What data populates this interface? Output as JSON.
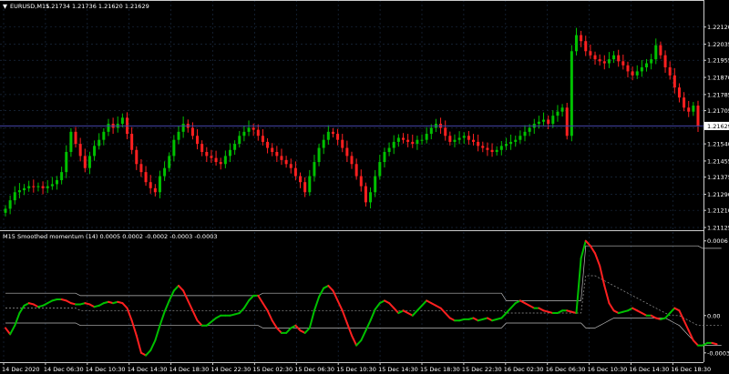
{
  "symbol_header": {
    "arrow": "▼",
    "title": "EURUSD,M15",
    "ohlc": "1.21734 1.21736 1.21620 1.21629"
  },
  "indicator_header": {
    "text": "M15 Smoothed momentum (14) 0.0005 0.0002 -0.0002 -0.0003 -0.0003"
  },
  "price_axis": {
    "ticks": [
      "1.22120",
      "1.22035",
      "1.21955",
      "1.21870",
      "1.21785",
      "1.21705",
      "1.21620",
      "1.21540",
      "1.21455",
      "1.21375",
      "1.21290",
      "1.21210",
      "1.21125"
    ],
    "current_price_label": "1.21629"
  },
  "indicator_axis": {
    "ticks": [
      "0.0006",
      "0.00",
      "-0.0003"
    ]
  },
  "time_axis": {
    "ticks": [
      "14 Dec 2020",
      "14 Dec 06:30",
      "14 Dec 10:30",
      "14 Dec 14:30",
      "14 Dec 18:30",
      "14 Dec 22:30",
      "15 Dec 02:30",
      "15 Dec 06:30",
      "15 Dec 10:30",
      "15 Dec 14:30",
      "15 Dec 18:30",
      "15 Dec 22:30",
      "16 Dec 02:30",
      "16 Dec 06:30",
      "16 Dec 10:30",
      "16 Dec 14:30",
      "16 Dec 18:30"
    ]
  },
  "colors": {
    "background": "#000000",
    "grid": "#1a2a40",
    "bull": "#00c000",
    "bear": "#ff2020",
    "current_line": "#4444aa",
    "frame": "#cccccc"
  },
  "chart_data": [
    {
      "type": "candlestick",
      "symbol": "EURUSD",
      "timeframe": "M15",
      "close": [
        1.21218,
        1.2126,
        1.213,
        1.2131,
        1.2132,
        1.2133,
        1.21325,
        1.2133,
        1.2132,
        1.2133,
        1.2134,
        1.2136,
        1.214,
        1.215,
        1.216,
        1.2154,
        1.2148,
        1.2142,
        1.2148,
        1.2153,
        1.2156,
        1.216,
        1.2164,
        1.2162,
        1.2164,
        1.2167,
        1.2159,
        1.2151,
        1.2144,
        1.214,
        1.2135,
        1.2132,
        1.213,
        1.2138,
        1.2142,
        1.2148,
        1.2156,
        1.216,
        1.2164,
        1.2162,
        1.2158,
        1.2154,
        1.215,
        1.2148,
        1.2147,
        1.2145,
        1.2144,
        1.2148,
        1.2151,
        1.2154,
        1.2158,
        1.216,
        1.2162,
        1.2161,
        1.2158,
        1.2155,
        1.2152,
        1.215,
        1.2148,
        1.2146,
        1.2144,
        1.2142,
        1.2138,
        1.2135,
        1.213,
        1.2138,
        1.2145,
        1.2152,
        1.2156,
        1.216,
        1.2159,
        1.2156,
        1.2152,
        1.2148,
        1.2144,
        1.2138,
        1.2133,
        1.2125,
        1.213,
        1.2138,
        1.2145,
        1.215,
        1.2152,
        1.2155,
        1.2157,
        1.2156,
        1.2155,
        1.2154,
        1.2156,
        1.2156,
        1.2159,
        1.2162,
        1.2164,
        1.2162,
        1.2158,
        1.2155,
        1.2156,
        1.2157,
        1.2158,
        1.2156,
        1.2155,
        1.2153,
        1.2152,
        1.2151,
        1.215,
        1.2151,
        1.2153,
        1.2154,
        1.2155,
        1.2156,
        1.2158,
        1.216,
        1.2162,
        1.2164,
        1.2165,
        1.2166,
        1.2164,
        1.2168,
        1.217,
        1.2172,
        1.2158,
        1.22,
        1.2208,
        1.2205,
        1.22,
        1.2198,
        1.2196,
        1.2195,
        1.2194,
        1.2196,
        1.2198,
        1.2195,
        1.2193,
        1.219,
        1.2188,
        1.219,
        1.2192,
        1.2194,
        1.2196,
        1.2203,
        1.2198,
        1.2192,
        1.2188,
        1.2182,
        1.2177,
        1.2172,
        1.217,
        1.2173,
        1.21629
      ],
      "ylim": [
        1.21125,
        1.222
      ],
      "current_price": 1.21629
    },
    {
      "type": "line",
      "title": "Smoothed momentum (14)",
      "series": [
        {
          "values": [
            -0.0001,
            -0.00015,
            -8e-05,
            2e-05,
            8e-05,
            0.0001,
            9e-05,
            7e-05,
            8e-05,
            0.0001,
            0.00012,
            0.00013,
            0.00013,
            0.00012,
            0.0001,
            9e-05,
            9e-05,
            0.0001,
            9e-05,
            7e-05,
            8e-05,
            0.0001,
            0.00011,
            0.0001,
            0.00011,
            0.0001,
            6e-05,
            -4e-05,
            -0.00016,
            -0.0003,
            -0.00032,
            -0.00028,
            -0.0002,
            -8e-05,
            3e-05,
            0.00012,
            0.0002,
            0.00024,
            0.0002,
            0.00012,
            4e-05,
            -4e-05,
            -8e-05,
            -8e-05,
            -5e-05,
            -2e-05,
            0.0,
            0.0,
            0.0,
            1e-05,
            2e-05,
            6e-05,
            0.00012,
            0.00016,
            0.00016,
            0.0001,
            4e-05,
            -4e-05,
            -0.0001,
            -0.00014,
            -0.00014,
            -0.0001,
            -8e-05,
            -0.00012,
            -0.00014,
            -0.0001,
            4e-05,
            0.00015,
            0.00022,
            0.00024,
            0.0002,
            0.00012,
            4e-05,
            -6e-05,
            -0.00016,
            -0.00024,
            -0.0002,
            -0.00012,
            -4e-05,
            5e-05,
            0.0001,
            0.00012,
            0.0001,
            6e-05,
            2e-05,
            4e-05,
            2e-05,
            0.0,
            4e-05,
            8e-05,
            0.00012,
            0.0001,
            8e-05,
            6e-05,
            2e-05,
            -2e-05,
            -4e-05,
            -4e-05,
            -3e-05,
            -3e-05,
            -2e-05,
            -4e-05,
            -3e-05,
            -2e-05,
            -4e-05,
            -3e-05,
            -2e-05,
            2e-05,
            6e-05,
            0.0001,
            0.00012,
            0.0001,
            8e-05,
            6e-05,
            6e-05,
            4e-05,
            3e-05,
            2e-05,
            2e-05,
            4e-05,
            4e-05,
            3e-05,
            2e-05,
            0.00046,
            0.0006,
            0.00056,
            0.0005,
            0.0004,
            0.00024,
            0.0001,
            4e-05,
            2e-05,
            3e-05,
            4e-05,
            6e-05,
            4e-05,
            2e-05,
            0.0,
            0.0,
            -2e-05,
            -3e-05,
            -2e-05,
            2e-05,
            6e-05,
            4e-05,
            -4e-05,
            -0.00012,
            -0.0002,
            -0.00024,
            -0.00024,
            -0.00022,
            -0.00022,
            -0.00023
          ]
        },
        {
          "values": [
            0.00018,
            0.00018,
            0.00018,
            0.00018,
            0.00018,
            0.00018,
            0.00018,
            0.00018,
            0.00018,
            0.00018,
            0.00018,
            0.00018,
            0.00018,
            0.00018,
            0.00018,
            0.00018,
            0.00016,
            0.00016,
            0.00016,
            0.00016,
            0.00016,
            0.00016,
            0.00016,
            0.00016,
            0.00016,
            0.00016,
            0.00016,
            0.00016,
            0.00016,
            0.00016,
            0.00016,
            0.00016,
            0.00016,
            0.00016,
            0.00016,
            0.00016,
            0.00016,
            0.00016,
            0.00016,
            0.00016,
            0.00016,
            0.00016,
            0.00016,
            0.00016,
            0.00016,
            0.00016,
            0.00016,
            0.00016,
            0.00016,
            0.00016,
            0.00016,
            0.00016,
            0.00016,
            0.00016,
            0.00016,
            0.00018,
            0.00018,
            0.00018,
            0.00018,
            0.00018,
            0.00018,
            0.00018,
            0.00018,
            0.00018,
            0.00018,
            0.00018,
            0.00018,
            0.00018,
            0.00018,
            0.00018,
            0.00018,
            0.00018,
            0.00018,
            0.00018,
            0.00018,
            0.00018,
            0.00018,
            0.00018,
            0.00018,
            0.00018,
            0.00018,
            0.00018,
            0.00018,
            0.00018,
            0.00018,
            0.00018,
            0.00018,
            0.00018,
            0.00018,
            0.00018,
            0.00018,
            0.00018,
            0.00018,
            0.00018,
            0.00018,
            0.00018,
            0.00018,
            0.00018,
            0.00018,
            0.00018,
            0.00018,
            0.00018,
            0.00018,
            0.00018,
            0.00018,
            0.00018,
            0.00018,
            0.00012,
            0.00012,
            0.00012,
            0.00012,
            0.00012,
            0.00012,
            0.00012,
            0.00012,
            0.00012,
            0.00012,
            0.00012,
            0.00012,
            0.00012,
            0.00012,
            0.00012,
            0.00012,
            0.00012,
            0.00056,
            0.00056,
            0.00056,
            0.00056,
            0.00056,
            0.00056,
            0.00056,
            0.00056,
            0.00056,
            0.00056,
            0.00056,
            0.00056,
            0.00056,
            0.00056,
            0.00056,
            0.00056,
            0.00056,
            0.00056,
            0.00056,
            0.00056,
            0.00056,
            0.00056,
            0.00056,
            0.00056,
            0.00056,
            0.00054,
            0.00054,
            0.00054,
            0.00054,
            0.00054
          ]
        },
        {
          "values": [
            6e-05,
            6e-05,
            6e-05,
            6e-05,
            6e-05,
            6e-05,
            6e-05,
            6e-05,
            6e-05,
            6e-05,
            6e-05,
            6e-05,
            6e-05,
            6e-05,
            6e-05,
            6e-05,
            4e-05,
            4e-05,
            4e-05,
            4e-05,
            4e-05,
            4e-05,
            4e-05,
            4e-05,
            4e-05,
            4e-05,
            4e-05,
            4e-05,
            4e-05,
            4e-05,
            4e-05,
            4e-05,
            4e-05,
            4e-05,
            4e-05,
            4e-05,
            4e-05,
            4e-05,
            4e-05,
            4e-05,
            4e-05,
            4e-05,
            4e-05,
            4e-05,
            4e-05,
            4e-05,
            4e-05,
            4e-05,
            4e-05,
            4e-05,
            4e-05,
            4e-05,
            4e-05,
            4e-05,
            4e-05,
            4e-05,
            4e-05,
            4e-05,
            4e-05,
            4e-05,
            4e-05,
            4e-05,
            4e-05,
            4e-05,
            4e-05,
            4e-05,
            4e-05,
            4e-05,
            4e-05,
            4e-05,
            4e-05,
            4e-05,
            4e-05,
            4e-05,
            4e-05,
            4e-05,
            4e-05,
            4e-05,
            4e-05,
            4e-05,
            4e-05,
            4e-05,
            4e-05,
            4e-05,
            4e-05,
            4e-05,
            4e-05,
            4e-05,
            4e-05,
            4e-05,
            4e-05,
            4e-05,
            4e-05,
            4e-05,
            4e-05,
            4e-05,
            4e-05,
            4e-05,
            4e-05,
            4e-05,
            4e-05,
            4e-05,
            4e-05,
            4e-05,
            4e-05,
            4e-05,
            4e-05,
            2e-05,
            2e-05,
            2e-05,
            2e-05,
            2e-05,
            2e-05,
            2e-05,
            2e-05,
            2e-05,
            2e-05,
            2e-05,
            2e-05,
            2e-05,
            2e-05,
            2e-05,
            2e-05,
            2e-05,
            0.00032,
            0.00032,
            0.00032,
            0.0003,
            0.00028,
            0.00026,
            0.00024,
            0.00022,
            0.0002,
            0.00018,
            0.00016,
            0.00014,
            0.00012,
            0.0001,
            8e-05,
            6e-05,
            4e-05,
            2e-05,
            0.0,
            0.0,
            0.0,
            -2e-05,
            -4e-05,
            -6e-05,
            -8e-05,
            -8e-05,
            -8e-05,
            -8e-05,
            -8e-05,
            -8e-05
          ]
        },
        {
          "values": [
            -6e-05,
            -6e-05,
            -6e-05,
            -6e-05,
            -6e-05,
            -6e-05,
            -6e-05,
            -6e-05,
            -6e-05,
            -6e-05,
            -6e-05,
            -6e-05,
            -6e-05,
            -6e-05,
            -6e-05,
            -6e-05,
            -8e-05,
            -8e-05,
            -8e-05,
            -8e-05,
            -8e-05,
            -8e-05,
            -8e-05,
            -8e-05,
            -8e-05,
            -8e-05,
            -8e-05,
            -8e-05,
            -8e-05,
            -8e-05,
            -8e-05,
            -8e-05,
            -8e-05,
            -8e-05,
            -8e-05,
            -8e-05,
            -8e-05,
            -8e-05,
            -8e-05,
            -8e-05,
            -8e-05,
            -8e-05,
            -8e-05,
            -8e-05,
            -8e-05,
            -8e-05,
            -8e-05,
            -8e-05,
            -8e-05,
            -8e-05,
            -8e-05,
            -8e-05,
            -8e-05,
            -8e-05,
            -8e-05,
            -0.0001,
            -0.0001,
            -0.0001,
            -0.0001,
            -0.0001,
            -0.0001,
            -0.0001,
            -0.0001,
            -0.0001,
            -0.0001,
            -0.0001,
            -0.0001,
            -0.0001,
            -0.0001,
            -0.0001,
            -0.0001,
            -0.0001,
            -0.0001,
            -0.0001,
            -0.0001,
            -0.0001,
            -0.0001,
            -0.0001,
            -0.0001,
            -0.0001,
            -0.0001,
            -0.0001,
            -0.0001,
            -0.0001,
            -0.0001,
            -0.0001,
            -0.0001,
            -0.0001,
            -0.0001,
            -0.0001,
            -0.0001,
            -0.0001,
            -0.0001,
            -0.0001,
            -0.0001,
            -0.0001,
            -0.0001,
            -0.0001,
            -0.0001,
            -0.0001,
            -0.0001,
            -0.0001,
            -0.0001,
            -0.0001,
            -0.0001,
            -0.0001,
            -0.0001,
            -6e-05,
            -6e-05,
            -6e-05,
            -6e-05,
            -6e-05,
            -6e-05,
            -6e-05,
            -6e-05,
            -6e-05,
            -6e-05,
            -6e-05,
            -6e-05,
            -6e-05,
            -6e-05,
            -6e-05,
            -6e-05,
            -6e-05,
            -0.0001,
            -0.0001,
            -0.0001,
            -8e-05,
            -6e-05,
            -4e-05,
            -2e-05,
            -2e-05,
            -2e-05,
            -2e-05,
            -2e-05,
            -2e-05,
            -2e-05,
            -2e-05,
            -2e-05,
            -2e-05,
            -2e-05,
            -2e-05,
            -4e-05,
            -6e-05,
            -8e-05,
            -0.00012,
            -0.00016,
            -0.0002,
            -0.00024,
            -0.00024,
            -0.00024,
            -0.00024,
            -0.00024,
            -0.00024
          ]
        }
      ],
      "ylim": [
        -0.00036,
        0.00062
      ]
    }
  ]
}
